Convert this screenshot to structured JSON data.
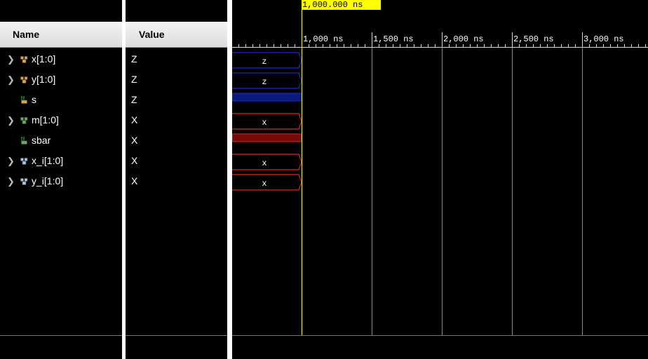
{
  "columns": {
    "name": "Name",
    "value": "Value"
  },
  "signals": [
    {
      "name": "x[1:0]",
      "value": "Z",
      "expandable": true,
      "icon": "bus-icon",
      "wave_label": "z",
      "state": "z"
    },
    {
      "name": "y[1:0]",
      "value": "Z",
      "expandable": true,
      "icon": "bus-icon",
      "wave_label": "z",
      "state": "z"
    },
    {
      "name": "s",
      "value": "Z",
      "expandable": false,
      "icon": "bit-icon",
      "wave_label": "",
      "state": "z"
    },
    {
      "name": "m[1:0]",
      "value": "X",
      "expandable": true,
      "icon": "bus-icon",
      "wave_label": "x",
      "state": "x"
    },
    {
      "name": "sbar",
      "value": "X",
      "expandable": false,
      "icon": "bit-icon",
      "wave_label": "",
      "state": "x"
    },
    {
      "name": "x_i[1:0]",
      "value": "X",
      "expandable": true,
      "icon": "bus-icon",
      "wave_label": "x",
      "state": "x"
    },
    {
      "name": "y_i[1:0]",
      "value": "X",
      "expandable": true,
      "icon": "bus-icon",
      "wave_label": "x",
      "state": "x"
    }
  ],
  "cursor": {
    "label": "1,000.000 ns",
    "time_ns": 1000
  },
  "timeline": {
    "ticks": [
      "1,000 ns",
      "1,500 ns",
      "2,000 ns",
      "2,500 ns",
      "3,000 ns"
    ],
    "tick_values_ns": [
      1000,
      1500,
      2000,
      2500,
      3000
    ]
  },
  "colors": {
    "z_state": "#1a2bd0",
    "x_state": "#e0261a",
    "cursor": "#ffff00",
    "grid": "#8a8a8a"
  }
}
